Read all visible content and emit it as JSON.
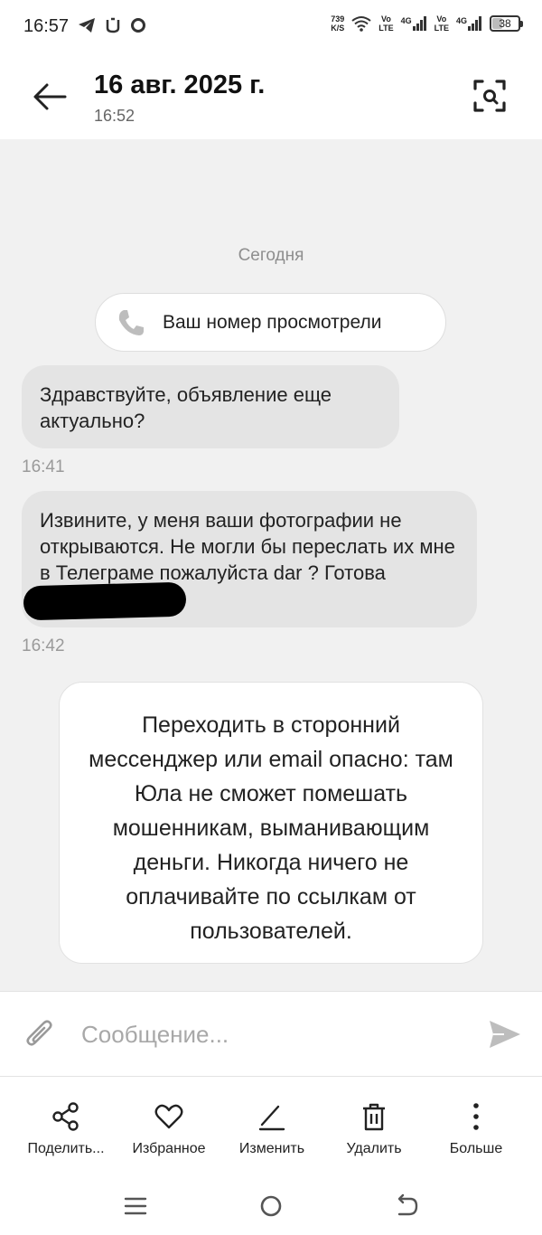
{
  "status_bar": {
    "time": "16:57",
    "net_speed_value": "739",
    "net_speed_unit": "K/S",
    "sim1_label_top": "Vo",
    "sim1_label_bottom": "LTE",
    "sim1_network": "4G",
    "sim2_label_top": "Vo",
    "sim2_label_bottom": "LTE",
    "sim2_network": "4G",
    "battery": "38",
    "battery_level": 0.38
  },
  "header": {
    "title": "16 авг. 2025 г.",
    "subtitle": "16:52"
  },
  "chat": {
    "date_divider": "Сегодня",
    "system_message": "Ваш номер просмотрели",
    "messages": [
      {
        "text": "Здравствуйте, объявление еще актуально?",
        "time": "16:41"
      },
      {
        "text": "Извините, у меня ваши фотографии не открываются. Не могли бы переслать их мне в Телеграме пожалуйста dar       ? Готова забрать",
        "time": "16:42"
      }
    ],
    "warning": "Переходить в сторонний мессенджер или email опасно: там Юла не сможет помешать мошенникам, выманивающим деньги. Никогда ничего не оплачивайте по ссылкам от пользователей."
  },
  "input": {
    "placeholder": "Сообщение..."
  },
  "actions": {
    "share": "Поделить...",
    "favorite": "Избранное",
    "edit": "Изменить",
    "delete": "Удалить",
    "more": "Больше"
  },
  "icons": {
    "back": "arrow-left-icon",
    "scan": "scan-icon",
    "phone": "phone-icon",
    "attach": "paperclip-icon",
    "send": "send-icon"
  },
  "colors": {
    "chat_background": "#f1f1f1",
    "bubble": "#e4e4e4",
    "muted_text": "#9a9a9a"
  }
}
